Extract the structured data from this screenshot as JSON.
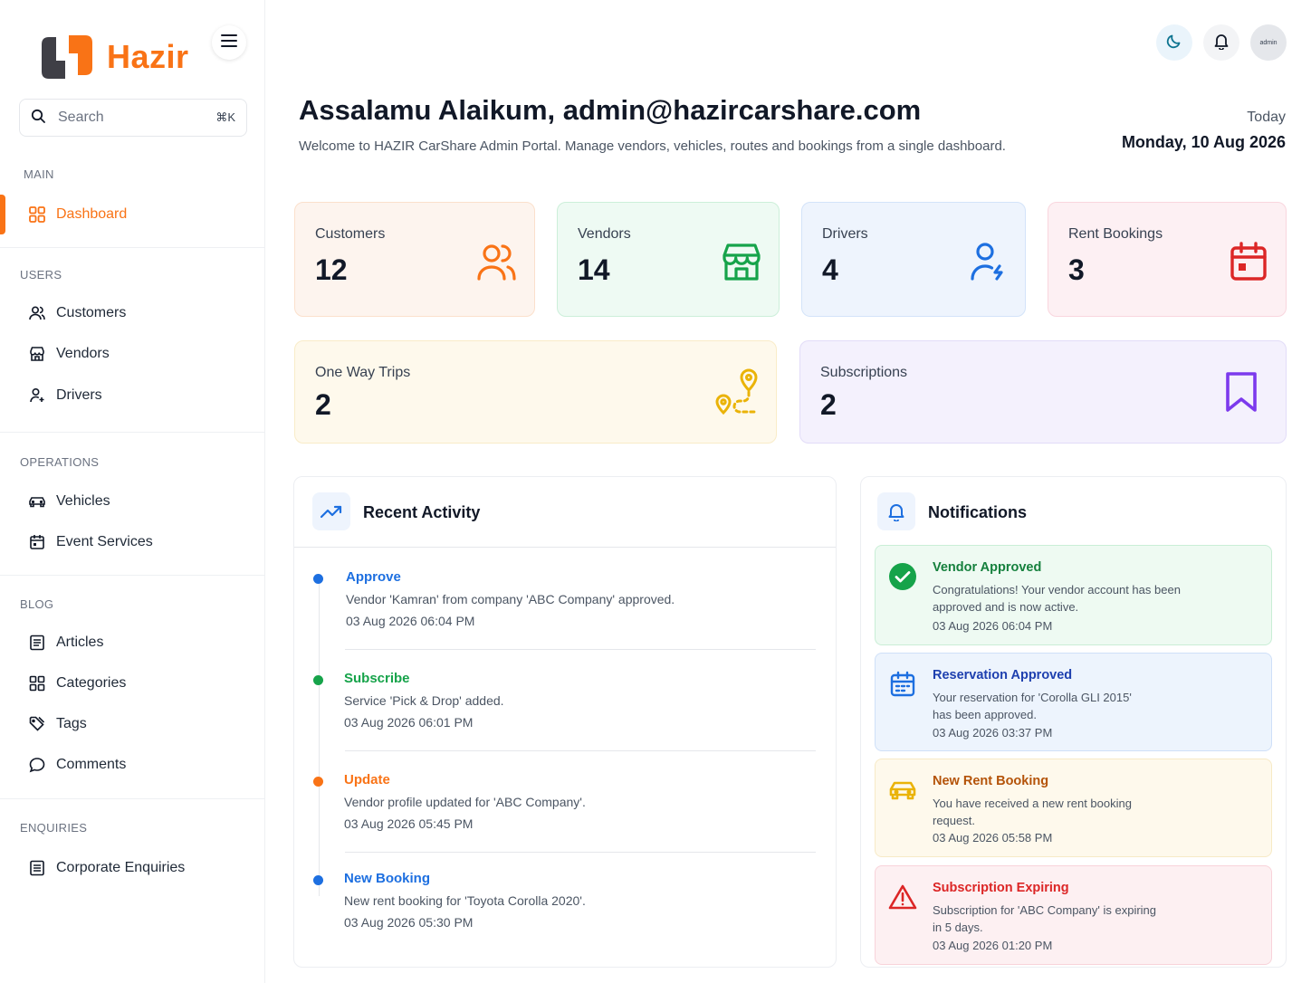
{
  "brand": {
    "name": "Hazir"
  },
  "search": {
    "placeholder": "Search",
    "shortcut": "⌘K"
  },
  "sidebar": {
    "sections": {
      "main": "MAIN",
      "users": "USERS",
      "operations": "OPERATIONS",
      "blog": "BLOG",
      "enquiries": "ENQUIRIES"
    },
    "items": {
      "dashboard": "Dashboard",
      "customers": "Customers",
      "vendors": "Vendors",
      "drivers": "Drivers",
      "vehicles": "Vehicles",
      "event_services": "Event Services",
      "articles": "Articles",
      "categories": "Categories",
      "tags": "Tags",
      "comments": "Comments",
      "corporate_enquiries": "Corporate Enquiries"
    }
  },
  "topbar": {
    "avatar_text": "admin"
  },
  "header": {
    "greeting": "Assalamu Alaikum, admin@hazircarshare.com",
    "subtitle": "Welcome to HAZIR CarShare Admin Portal. Manage vendors, vehicles, routes and bookings from a single dashboard.",
    "today_label": "Today",
    "today_date": "Monday, 10 Aug 2026"
  },
  "stats": {
    "customers": {
      "label": "Customers",
      "value": "12"
    },
    "vendors": {
      "label": "Vendors",
      "value": "14"
    },
    "drivers": {
      "label": "Drivers",
      "value": "4"
    },
    "rent_bookings": {
      "label": "Rent Bookings",
      "value": "3"
    },
    "one_way_trips": {
      "label": "One Way Trips",
      "value": "2"
    },
    "subscriptions": {
      "label": "Subscriptions",
      "value": "2"
    }
  },
  "activity": {
    "title": "Recent Activity",
    "items": [
      {
        "title": "Approve",
        "desc": "Vendor 'Kamran' from company 'ABC Company' approved.",
        "time": "03 Aug 2026 06:04 PM",
        "color": "#1d6fe0"
      },
      {
        "title": "Subscribe",
        "desc": "Service 'Pick & Drop' added.",
        "time": "03 Aug 2026 06:01 PM",
        "color": "#16a34a"
      },
      {
        "title": "Update",
        "desc": "Vendor profile updated for 'ABC Company'.",
        "time": "03 Aug 2026 05:45 PM",
        "color": "#f97316"
      },
      {
        "title": "New Booking",
        "desc": "New rent booking for 'Toyota Corolla 2020'.",
        "time": "03 Aug 2026 05:30 PM",
        "color": "#1d6fe0"
      }
    ]
  },
  "notifications": {
    "title": "Notifications",
    "items": [
      {
        "title": "Vendor Approved",
        "desc": "Congratulations! Your vendor account has been approved and is now active.",
        "time": "03 Aug 2026 06:04 PM"
      },
      {
        "title": "Reservation Approved",
        "desc": "Your reservation for 'Corolla GLI 2015' has been approved.",
        "time": "03 Aug 2026 03:37 PM"
      },
      {
        "title": "New Rent Booking",
        "desc": "You have received a new rent booking request.",
        "time": "03 Aug 2026 05:58 PM"
      },
      {
        "title": "Subscription Expiring",
        "desc": "Subscription for 'ABC Company' is expiring in 5 days.",
        "time": "03 Aug 2026 01:20 PM"
      }
    ]
  },
  "colors": {
    "accent": "#f97316",
    "success": "#16a34a",
    "info": "#1d4ed8",
    "warning": "#b45309",
    "danger": "#dc2626",
    "purple": "#7c3aed"
  }
}
